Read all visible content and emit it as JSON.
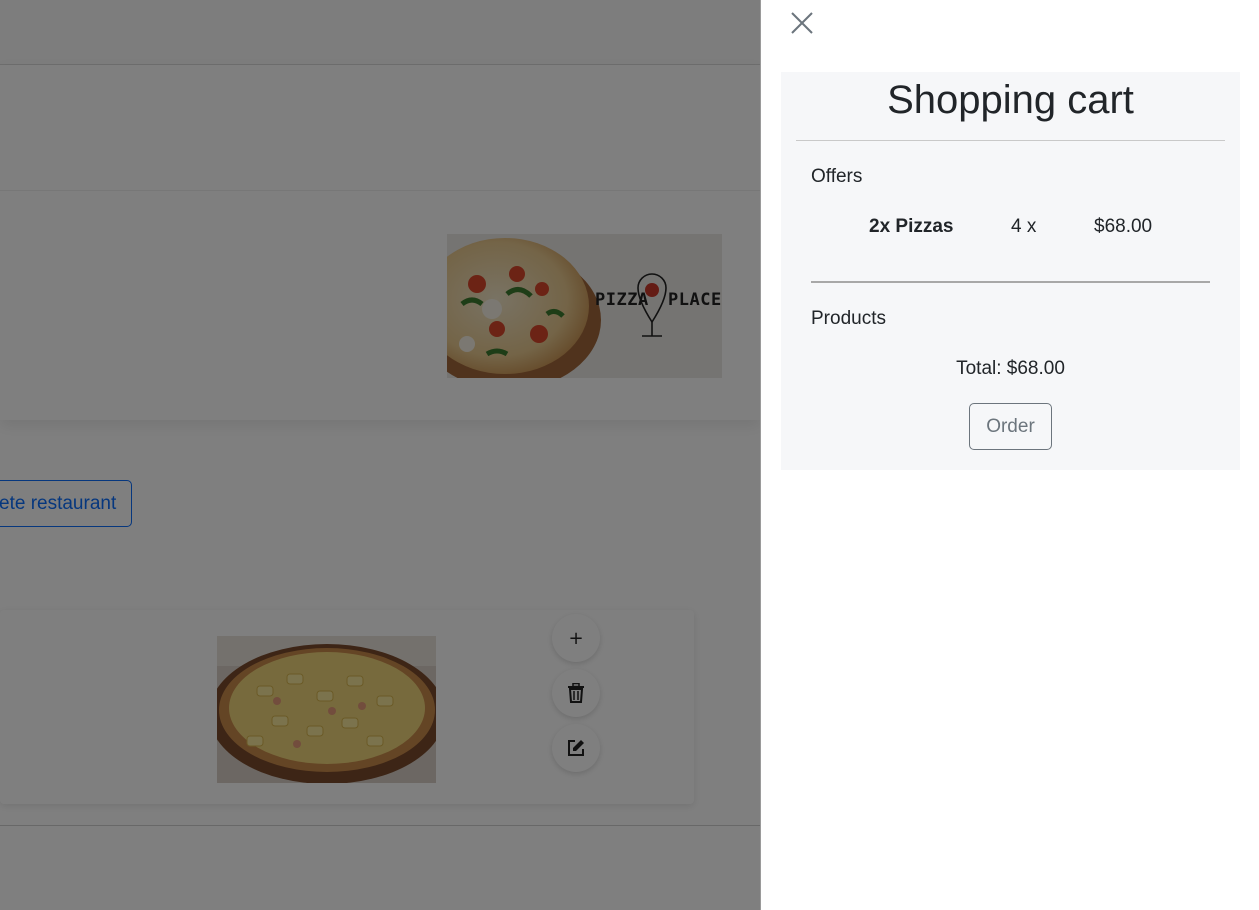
{
  "background": {
    "banner_logo_left": "PIZZA",
    "banner_logo_right": "PLACE",
    "delete_button_label": "ete restaurant",
    "product_actions": {
      "add_label": "+"
    }
  },
  "cart": {
    "title": "Shopping cart",
    "offers_label": "Offers",
    "offers": [
      {
        "name": "2x Pizzas",
        "quantity": "4 x",
        "price": "$68.00"
      }
    ],
    "products_label": "Products",
    "total": "Total: $68.00",
    "order_label": "Order"
  },
  "colors": {
    "primary": "#0d6efd",
    "secondary": "#6c757d",
    "panel_bg": "#f6f7f9",
    "overlay": "rgba(0,0,0,0.5)"
  },
  "icons": [
    "close-icon",
    "plus-icon",
    "trash-icon",
    "edit-icon"
  ]
}
